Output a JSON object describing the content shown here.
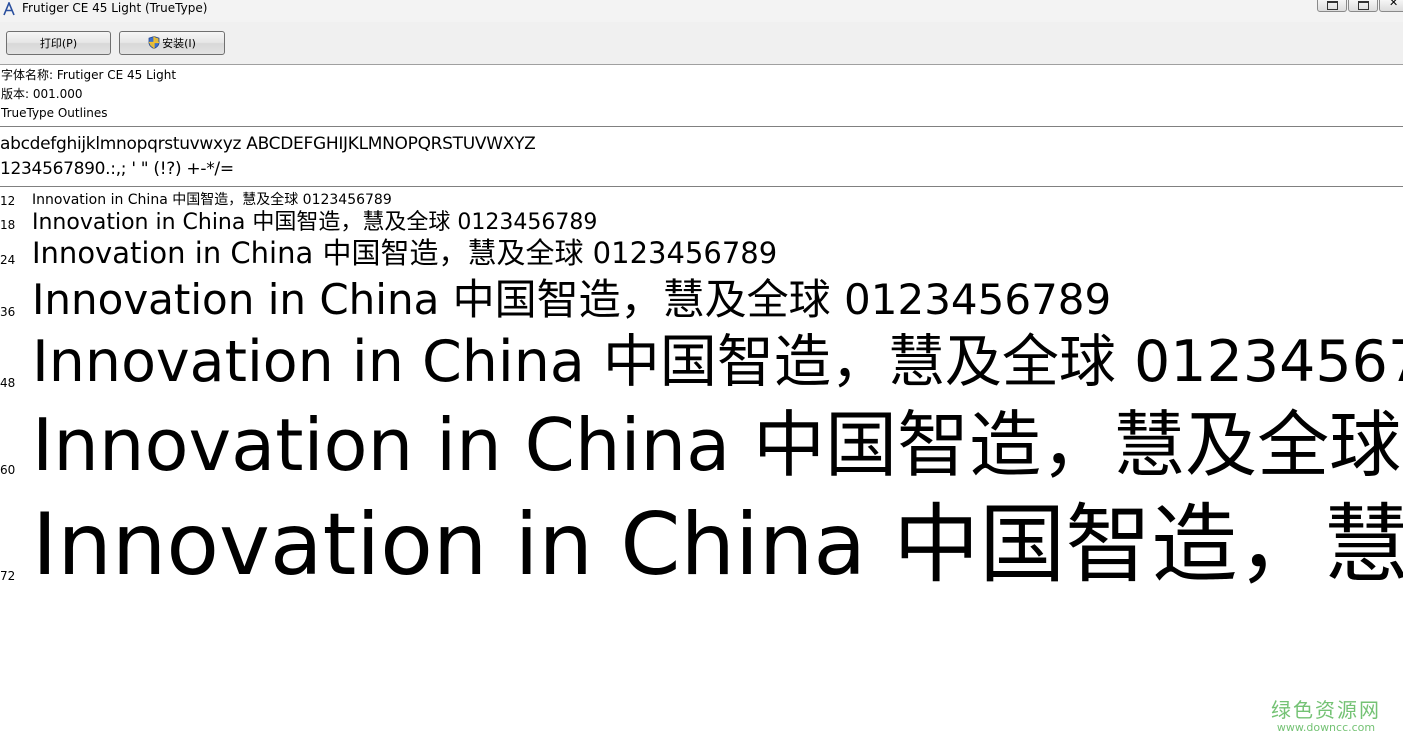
{
  "window": {
    "title": "Frutiger CE 45 Light (TrueType)",
    "icon": "font-file-icon"
  },
  "toolbar": {
    "print_label": "打印(P)",
    "install_label": "安装(I)"
  },
  "info": {
    "font_name": "字体名称: Frutiger CE 45 Light",
    "version": "版本: 001.000",
    "outlines": "TrueType Outlines"
  },
  "charset": {
    "line1": "abcdefghijklmnopqrstuvwxyz ABCDEFGHIJKLMNOPQRSTUVWXYZ",
    "line2": "1234567890.:,; ' \" (!?) +-*/="
  },
  "sample_text": "Innovation in China 中国智造，慧及全球 0123456789",
  "samples": [
    {
      "size": "12"
    },
    {
      "size": "18"
    },
    {
      "size": "24"
    },
    {
      "size": "36"
    },
    {
      "size": "48"
    },
    {
      "size": "60"
    },
    {
      "size": "72"
    }
  ],
  "watermark": {
    "name": "绿色资源网",
    "url": "www.downcc.com"
  }
}
